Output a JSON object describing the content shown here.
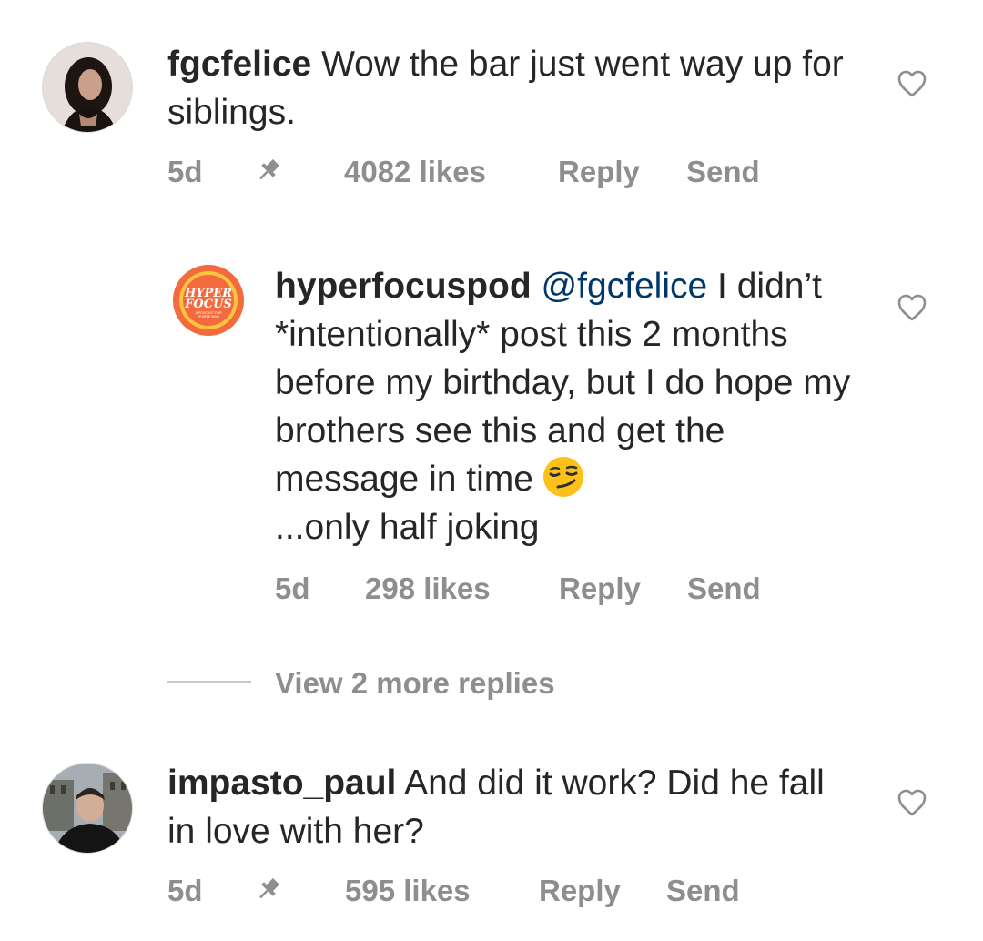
{
  "comments": [
    {
      "username": "fgcfelice",
      "text": "Wow the bar just went way up for siblings.",
      "time": "5d",
      "likes": "4082 likes",
      "reply": "Reply",
      "send": "Send",
      "pinned": true
    },
    {
      "username": "hyperfocuspod",
      "mention": "@fgcfelice",
      "text": "I didn’t *intentionally* post this 2 months before my birthday, but I do hope my brothers see this and get the message in time",
      "text_after_emoji": "...only half joking",
      "emoji": "smirking-face",
      "time": "5d",
      "likes": "298 likes",
      "reply": "Reply",
      "send": "Send",
      "avatar_text": [
        "HYPER",
        "FOCUS",
        "A PODCAST FOR",
        "PEOPLE WHO"
      ]
    },
    {
      "username": "impasto_paul",
      "text": "And did it work? Did he fall in love with her?",
      "time": "5d",
      "likes": "595 likes",
      "reply": "Reply",
      "send": "Send",
      "pinned": true
    }
  ],
  "view_more": "View 2 more replies",
  "colors": {
    "text": "#262626",
    "meta": "#8e8e8e",
    "mention": "#00376b",
    "hyperfocus_orange": "#f26a3d",
    "hyperfocus_yellow": "#f9c440"
  }
}
